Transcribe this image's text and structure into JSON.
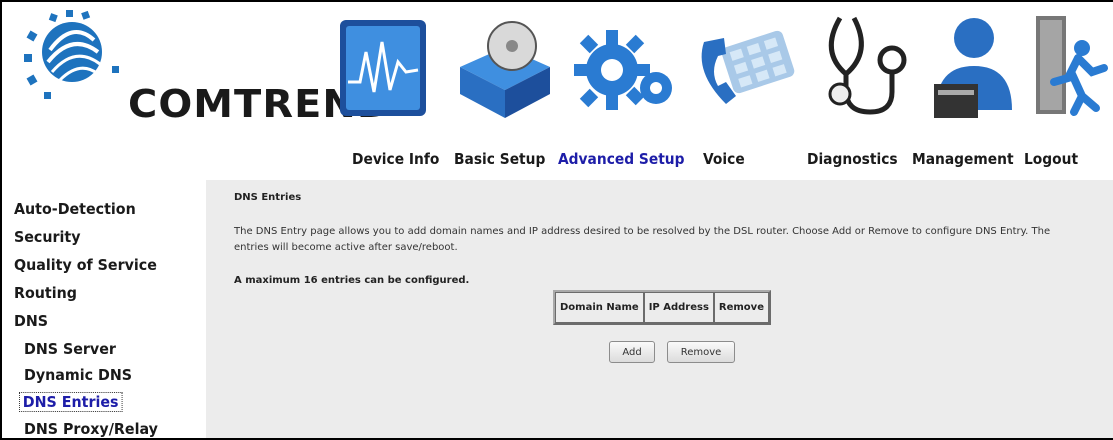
{
  "brand": {
    "name": "COMTREND"
  },
  "nav": [
    {
      "label": "Device Info",
      "icon": "device-info-icon",
      "active": false
    },
    {
      "label": "Basic Setup",
      "icon": "basic-setup-icon",
      "active": false
    },
    {
      "label": "Advanced Setup",
      "icon": "advanced-setup-icon",
      "active": true
    },
    {
      "label": "Voice",
      "icon": "voice-icon",
      "active": false
    },
    {
      "label": "Diagnostics",
      "icon": "diagnostics-icon",
      "active": false
    },
    {
      "label": "Management",
      "icon": "management-icon",
      "active": false
    },
    {
      "label": "Logout",
      "icon": "logout-icon",
      "active": false
    }
  ],
  "sidebar": {
    "items": [
      {
        "label": "Auto-Detection"
      },
      {
        "label": "Security"
      },
      {
        "label": "Quality of Service"
      },
      {
        "label": "Routing"
      },
      {
        "label": "DNS"
      },
      {
        "label": "DNS Server"
      },
      {
        "label": "Dynamic DNS"
      },
      {
        "label": "DNS Entries"
      },
      {
        "label": "DNS Proxy/Relay"
      }
    ],
    "selected": "DNS Entries"
  },
  "main": {
    "title": "DNS Entries",
    "description": "The DNS Entry page allows you to add domain names and IP address desired to be resolved by the DSL router. Choose Add or Remove to configure DNS Entry. The entries will become active after save/reboot.",
    "max_note": "A maximum 16 entries can be configured.",
    "table": {
      "columns": [
        "Domain Name",
        "IP Address",
        "Remove"
      ],
      "rows": []
    },
    "buttons": {
      "add": "Add",
      "remove": "Remove"
    }
  },
  "colors": {
    "active_nav": "#1d1da8",
    "content_bg": "#ececec",
    "brand_blue": "#1e73be"
  }
}
